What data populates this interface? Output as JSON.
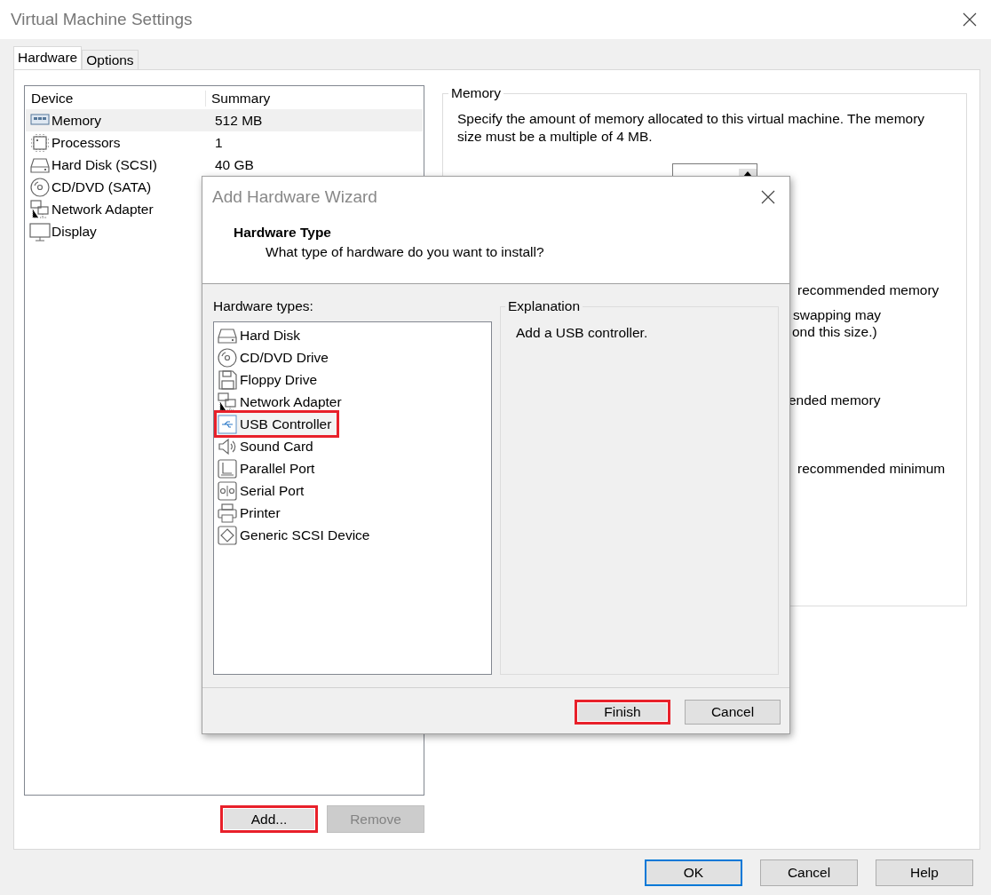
{
  "window": {
    "title": "Virtual Machine Settings"
  },
  "tabs": [
    {
      "label": "Hardware",
      "selected": true
    },
    {
      "label": "Options",
      "selected": false
    }
  ],
  "devices": {
    "columns": [
      "Device",
      "Summary"
    ],
    "rows": [
      {
        "kind": "memory",
        "name": "Memory",
        "summary": "512 MB",
        "selected": true
      },
      {
        "kind": "processor",
        "name": "Processors",
        "summary": "1",
        "selected": false
      },
      {
        "kind": "harddisk",
        "name": "Hard Disk (SCSI)",
        "summary": "40 GB",
        "selected": false
      },
      {
        "kind": "cdrom",
        "name": "CD/DVD (SATA)",
        "selected": false
      },
      {
        "kind": "network",
        "name": "Network Adapter",
        "selected": false
      },
      {
        "kind": "display",
        "name": "Display",
        "selected": false
      }
    ]
  },
  "device_buttons": [
    {
      "label": "Add...",
      "disabled": false,
      "highlighted": true
    },
    {
      "label": "Remove",
      "disabled": true,
      "highlighted": false
    }
  ],
  "memory_panel": {
    "title": "Memory",
    "description": "Specify the amount of memory allocated to this virtual machine. The memory size must be a multiple of 4 MB.",
    "fragments": [
      "recommended memory",
      "swapping may",
      "ond this size.)",
      "ended memory",
      "recommended minimum"
    ]
  },
  "dialog_buttons": [
    {
      "label": "OK",
      "default": true
    },
    {
      "label": "Cancel",
      "default": false
    },
    {
      "label": "Help",
      "default": false
    }
  ],
  "wizard": {
    "title": "Add Hardware Wizard",
    "heading": "Hardware Type",
    "subheading": "What type of hardware do you want to install?",
    "list_label": "Hardware types:",
    "hardware_types": [
      {
        "kind": "harddisk",
        "label": "Hard Disk",
        "selected": false,
        "highlighted": false
      },
      {
        "kind": "cdrom",
        "label": "CD/DVD Drive",
        "selected": false,
        "highlighted": false
      },
      {
        "kind": "floppy",
        "label": "Floppy Drive",
        "selected": false,
        "highlighted": false
      },
      {
        "kind": "network",
        "label": "Network Adapter",
        "selected": false,
        "highlighted": false
      },
      {
        "kind": "usb",
        "label": "USB Controller",
        "selected": true,
        "highlighted": true
      },
      {
        "kind": "sound",
        "label": "Sound Card",
        "selected": false,
        "highlighted": false
      },
      {
        "kind": "parallel",
        "label": "Parallel Port",
        "selected": false,
        "highlighted": false
      },
      {
        "kind": "serial",
        "label": "Serial Port",
        "selected": false,
        "highlighted": false
      },
      {
        "kind": "printer",
        "label": "Printer",
        "selected": false,
        "highlighted": false
      },
      {
        "kind": "scsi",
        "label": "Generic SCSI Device",
        "selected": false,
        "highlighted": false
      }
    ],
    "explanation_title": "Explanation",
    "explanation": "Add a USB controller.",
    "buttons": [
      {
        "label": "Finish",
        "highlighted": true
      },
      {
        "label": "Cancel",
        "highlighted": false
      }
    ]
  }
}
